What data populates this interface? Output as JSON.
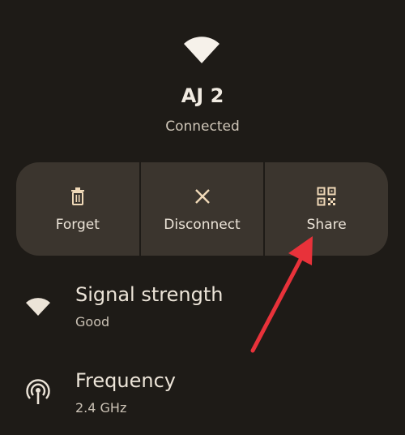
{
  "network": {
    "name": "AJ 2",
    "status": "Connected"
  },
  "actions": [
    {
      "label": "Forget",
      "icon": "trash-icon"
    },
    {
      "label": "Disconnect",
      "icon": "close-icon"
    },
    {
      "label": "Share",
      "icon": "qr-code-icon"
    }
  ],
  "details": [
    {
      "title": "Signal strength",
      "value": "Good",
      "icon": "wifi-signal-icon"
    },
    {
      "title": "Frequency",
      "value": "2.4 GHz",
      "icon": "frequency-icon"
    }
  ],
  "colors": {
    "background": "#1e1b17",
    "button_bar": "#3b352e",
    "icon_accent": "#f0d9b8",
    "annotation_arrow": "#e8323a"
  }
}
